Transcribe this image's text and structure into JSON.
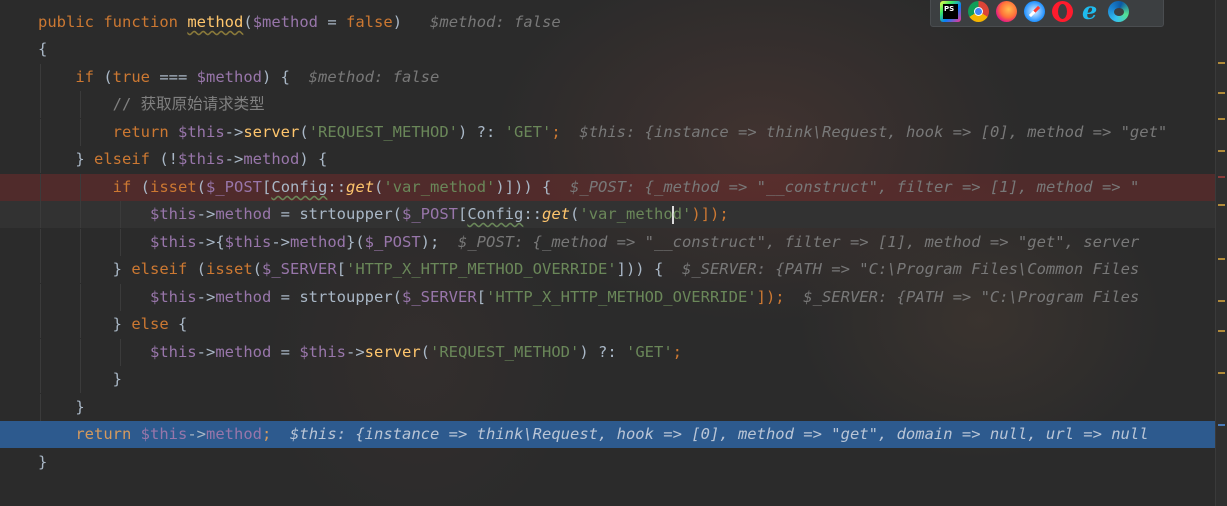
{
  "editor": {
    "lines": [
      {
        "type": "sig",
        "kw1": "public",
        "kw2": "function",
        "name": "method",
        "p1": "(",
        "param": "$method",
        "p2": " = ",
        "bool": "false",
        "p3": ")",
        "hint": "$method: false"
      },
      {
        "type": "brace",
        "text": "{"
      },
      {
        "type": "if1",
        "kw": "if",
        "t1": " (",
        "bool": "true",
        "t2": " === ",
        "var": "$method",
        "t3": ") {",
        "hint": "$method: false"
      },
      {
        "type": "comment",
        "text": "// 获取原始请求类型"
      },
      {
        "type": "ret1",
        "kw": "return",
        "var": "$this",
        "arrow": "->",
        "fn": "server",
        "t1": "(",
        "str": "'REQUEST_METHOD'",
        "t2": ") ?: ",
        "str2": "'GET'",
        "semi": ";",
        "hint": "$this: {instance => think\\Request, hook => [0], method => \"get\""
      },
      {
        "type": "elseif1",
        "t0": "} ",
        "kw": "elseif",
        "t1": " (!",
        "var": "$this",
        "arrow": "->",
        "prop": "method",
        "t2": ") {"
      },
      {
        "type": "if2",
        "kw": "if",
        "t1": " (",
        "kw2": "isset",
        "t2": "(",
        "var": "$_POST",
        "t3": "[",
        "cls": "Config",
        "dc": "::",
        "sfn": "get",
        "t4": "(",
        "str": "'var_method'",
        "t5": ")])) {",
        "hint": "$_POST: {_method => \"__construct\", filter => [1], method => \""
      },
      {
        "type": "assign1",
        "var": "$this",
        "arrow": "->",
        "prop": "method",
        "t1": " = ",
        "fn": "strtoupper",
        "t2": "(",
        "var2": "$_POST",
        "t3": "[",
        "cls": "Config",
        "dc": "::",
        "sfn": "get",
        "t4": "(",
        "str_a": "'var_metho",
        "str_b": "d'",
        "t5": ")]);"
      },
      {
        "type": "call1",
        "var": "$this",
        "t1": "->{",
        "var2": "$this",
        "arrow": "->",
        "prop": "method",
        "t2": "}(",
        "var3": "$_POST",
        "t3": ");",
        "hint": "$_POST: {_method => \"__construct\", filter => [1], method => \"get\", server"
      },
      {
        "type": "elseif2",
        "t0": "} ",
        "kw": "elseif",
        "t1": " (",
        "kw2": "isset",
        "t2": "(",
        "var": "$_SERVER",
        "t3": "[",
        "str": "'HTTP_X_HTTP_METHOD_OVERRIDE'",
        "t4": "])) {",
        "hint": "$_SERVER: {PATH => \"C:\\Program Files\\Common Files"
      },
      {
        "type": "assign2",
        "var": "$this",
        "arrow": "->",
        "prop": "method",
        "t1": " = ",
        "fn": "strtoupper",
        "t2": "(",
        "var2": "$_SERVER",
        "t3": "[",
        "str": "'HTTP_X_HTTP_METHOD_OVERRIDE'",
        "t4": "]);",
        "hint": "$_SERVER: {PATH => \"C:\\Program Files"
      },
      {
        "type": "else",
        "t0": "} ",
        "kw": "else",
        "t1": " {"
      },
      {
        "type": "assign3",
        "var": "$this",
        "arrow": "->",
        "prop": "method",
        "t1": " = ",
        "var2": "$this",
        "arrow2": "->",
        "fn": "server",
        "t2": "(",
        "str": "'REQUEST_METHOD'",
        "t3": ") ?: ",
        "str2": "'GET'",
        "semi": ";"
      },
      {
        "type": "close",
        "text": "}"
      },
      {
        "type": "close",
        "text": "}"
      },
      {
        "type": "ret2",
        "kw": "return",
        "var": "$this",
        "arrow": "->",
        "prop": "method",
        "semi": ";",
        "hint": "$this: {instance => think\\Request, hook => [0], method => \"get\", domain => null, url => null"
      },
      {
        "type": "close",
        "text": "}"
      }
    ]
  },
  "browser_bar": {
    "icons": [
      "phpstorm-icon",
      "chrome-icon",
      "firefox-icon",
      "safari-icon",
      "opera-icon",
      "ie-icon",
      "edge-icon"
    ]
  },
  "colors": {
    "keyword": "#cc7832",
    "variable": "#9876aa",
    "function": "#ffc66d",
    "string": "#6a8759",
    "comment": "#808080",
    "breakpoint_line": "#5a2a2a",
    "execution_line": "#2d5a8e"
  }
}
